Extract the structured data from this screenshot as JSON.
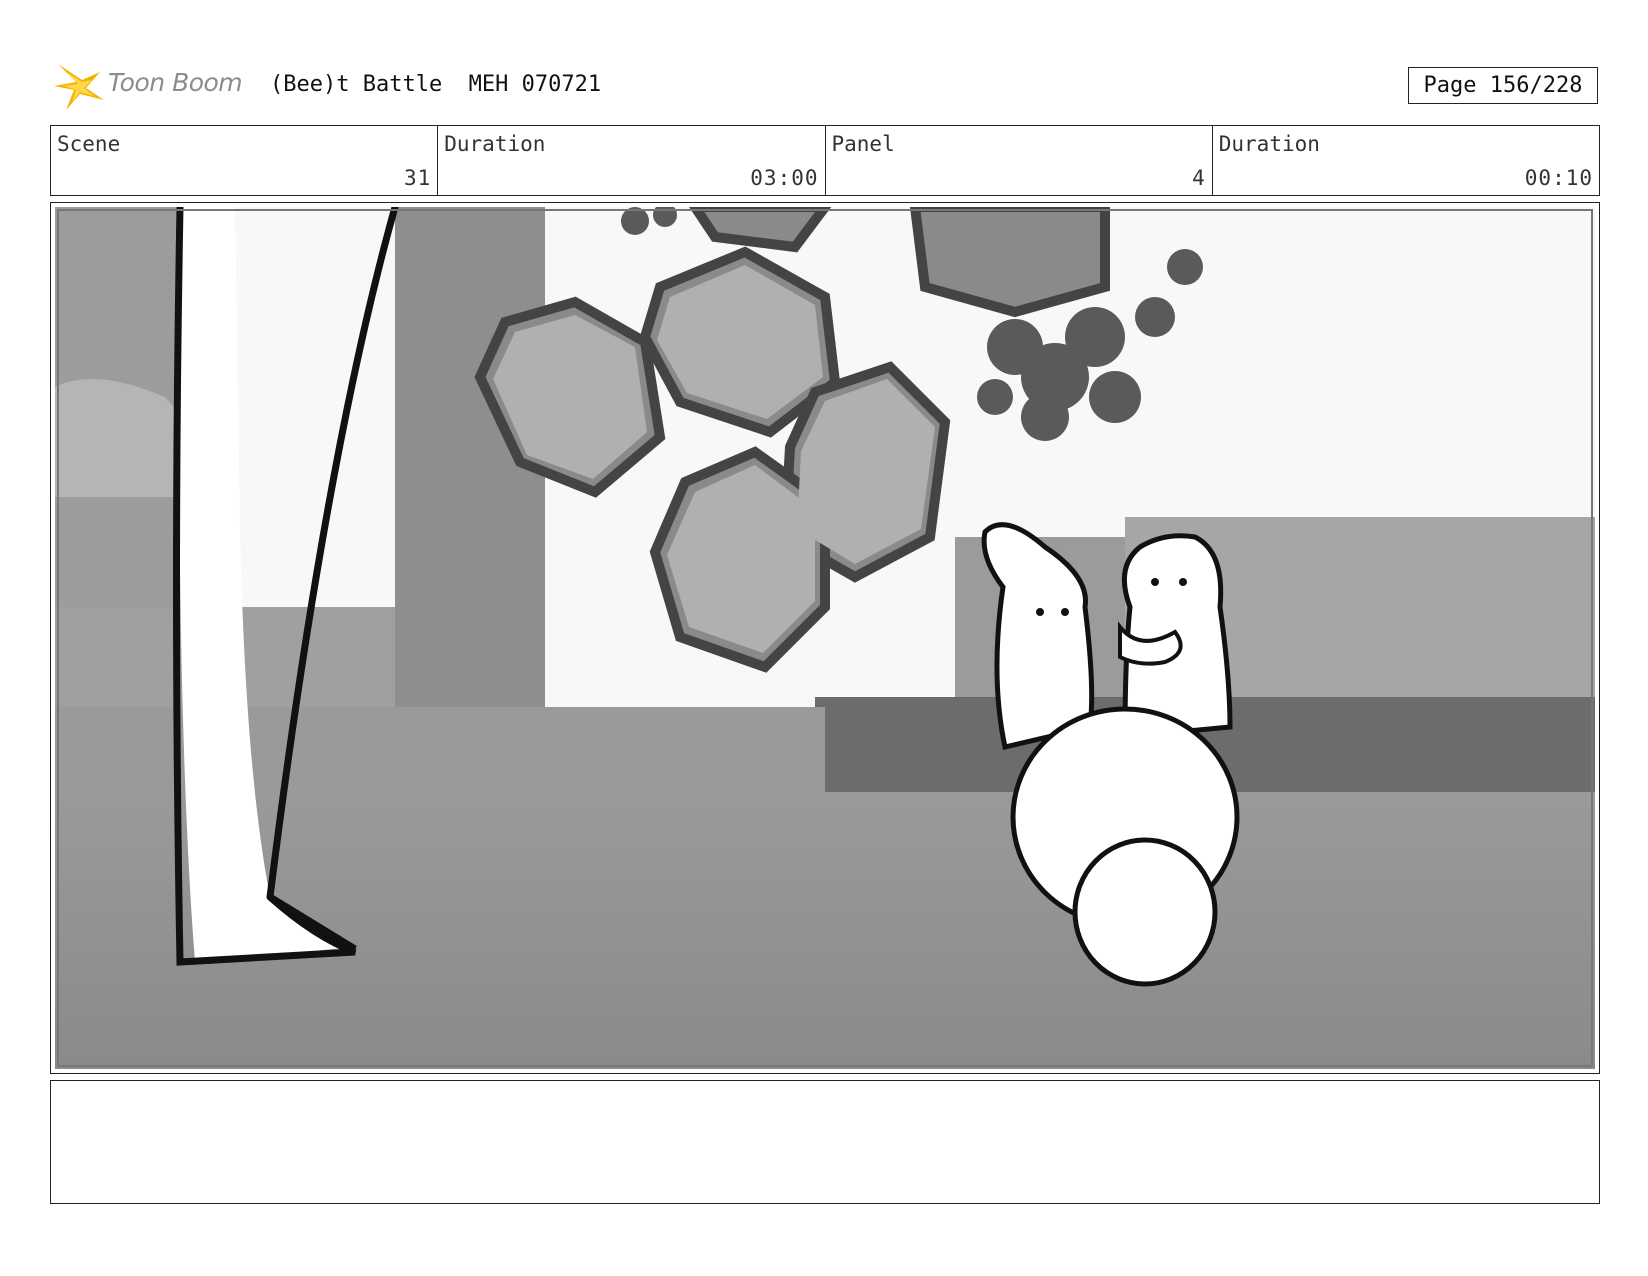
{
  "header": {
    "logo_text": "Toon Boom",
    "title": "(Bee)t Battle  MEH 070721",
    "page": "Page 156/228"
  },
  "info": {
    "scene_label": "Scene",
    "scene_value": "31",
    "scene_duration_label": "Duration",
    "scene_duration_value": "03:00",
    "panel_label": "Panel",
    "panel_value": "4",
    "panel_duration_label": "Duration",
    "panel_duration_value": "00:10"
  },
  "notes": {
    "text": ""
  }
}
